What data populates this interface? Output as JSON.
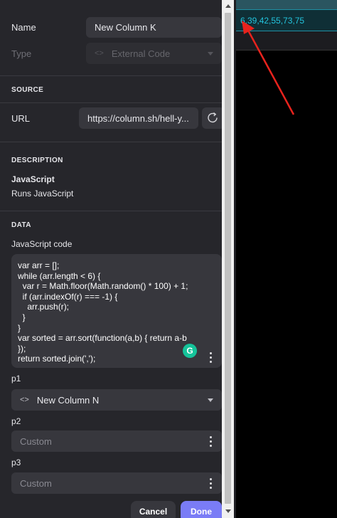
{
  "name_label": "Name",
  "name_value": "New Column K",
  "type_label": "Type",
  "type_value": "External Code",
  "source": {
    "title": "SOURCE",
    "url_label": "URL",
    "url_value": "https://column.sh/hell-y..."
  },
  "description": {
    "title": "DESCRIPTION",
    "name": "JavaScript",
    "text": "Runs JavaScript"
  },
  "data": {
    "title": "DATA",
    "code_label": "JavaScript code",
    "code": "var arr = [];\nwhile (arr.length < 6) {\n  var r = Math.floor(Math.random() * 100) + 1;\n  if (arr.indexOf(r) === -1) {\n    arr.push(r);\n  }\n}\nvar sorted = arr.sort(function(a,b) { return a-b\n});\nreturn sorted.join(',');",
    "p1_label": "p1",
    "p1_value": "New Column N",
    "p2_label": "p2",
    "p2_placeholder": "Custom",
    "p3_label": "p3",
    "p3_placeholder": "Custom"
  },
  "buttons": {
    "cancel": "Cancel",
    "done": "Done"
  },
  "cell_value": "6,39,42,55,73,75",
  "colors": {
    "panel_bg": "#26262b",
    "field_bg": "#37373d",
    "accent": "#7a7cf6",
    "cell_text": "#23c4dd",
    "arrow": "#e8231d",
    "grammarly": "#15c39a"
  },
  "icons": [
    "code-brackets-icon",
    "chevron-down-icon",
    "refresh-icon",
    "more-vertical-icon",
    "grammarly-icon",
    "annotation-arrow"
  ]
}
